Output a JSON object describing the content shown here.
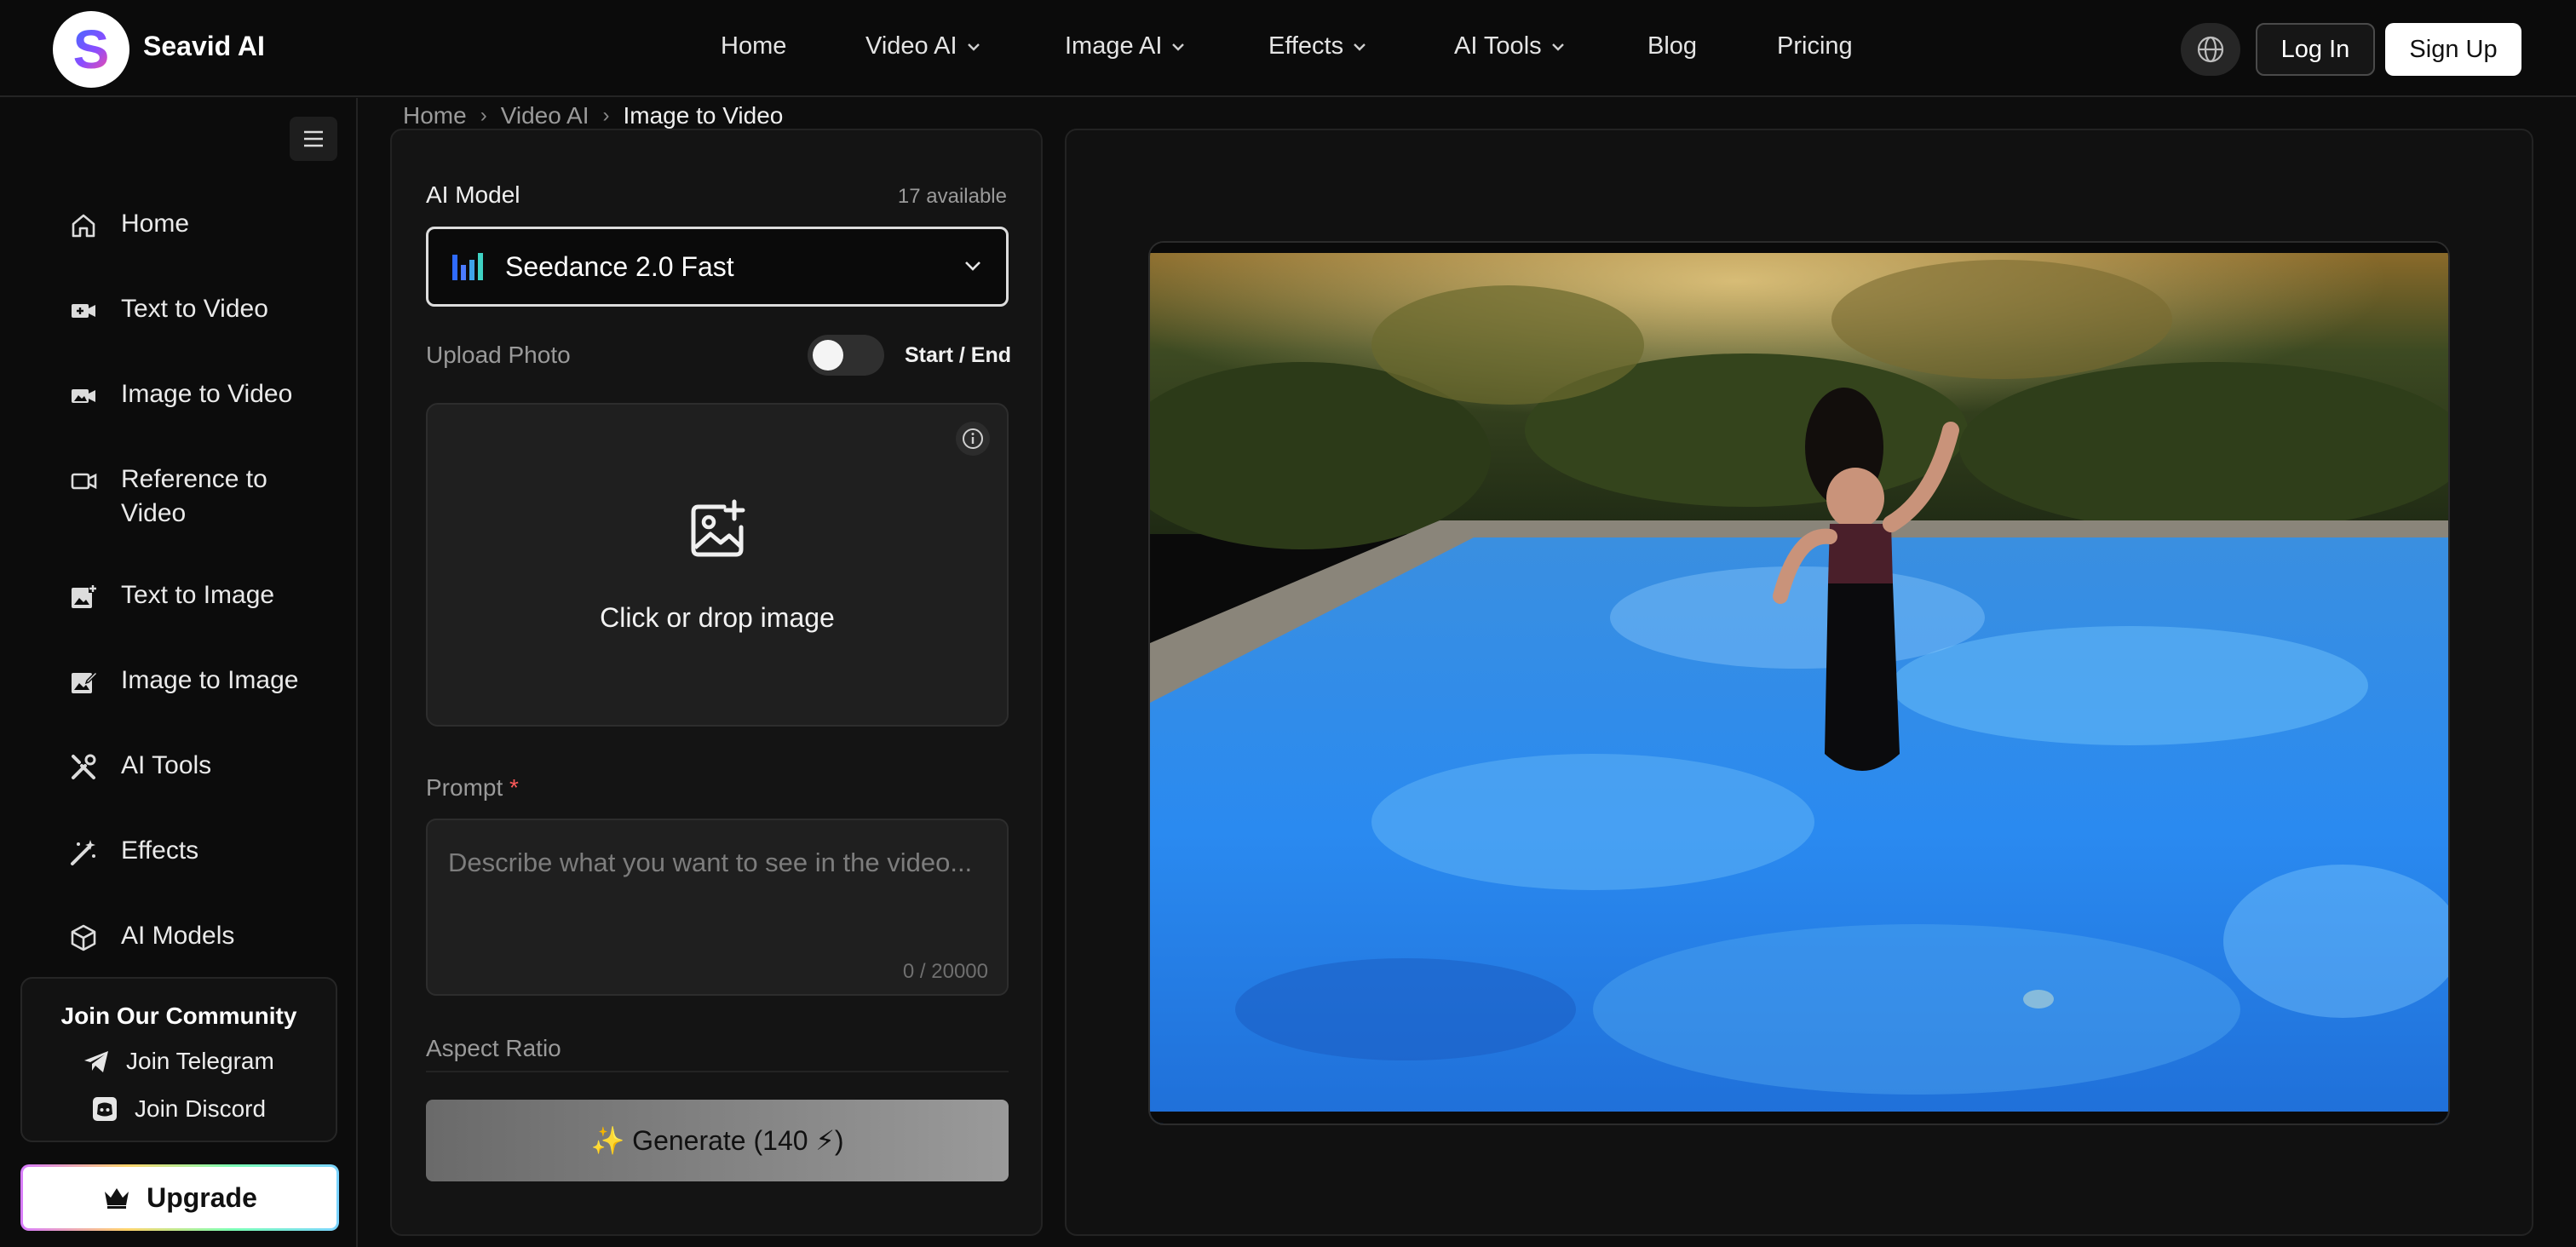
{
  "brand": {
    "logo_letter": "S",
    "name": "Seavid AI"
  },
  "nav": {
    "items": [
      {
        "label": "Home",
        "dropdown": false
      },
      {
        "label": "Video AI",
        "dropdown": true
      },
      {
        "label": "Image AI",
        "dropdown": true
      },
      {
        "label": "Effects",
        "dropdown": true
      },
      {
        "label": "AI Tools",
        "dropdown": true
      },
      {
        "label": "Blog",
        "dropdown": false
      },
      {
        "label": "Pricing",
        "dropdown": false
      }
    ],
    "language_icon": "globe-icon",
    "login_label": "Log In",
    "signup_label": "Sign Up"
  },
  "sidebar": {
    "items": [
      {
        "label": "Home",
        "icon": "home-icon"
      },
      {
        "label": "Text to Video",
        "icon": "video-plus-icon"
      },
      {
        "label": "Image to Video",
        "icon": "image-video-icon"
      },
      {
        "label": "Reference to Video",
        "icon": "video-camera-icon"
      },
      {
        "label": "Text to Image",
        "icon": "image-plus-icon"
      },
      {
        "label": "Image to Image",
        "icon": "image-edit-icon"
      },
      {
        "label": "AI Tools",
        "icon": "tools-icon"
      },
      {
        "label": "Effects",
        "icon": "magic-wand-icon"
      },
      {
        "label": "AI Models",
        "icon": "cube-icon"
      }
    ],
    "community": {
      "title": "Join Our Community",
      "telegram_label": "Join Telegram",
      "discord_label": "Join Discord"
    },
    "upgrade_label": "Upgrade"
  },
  "breadcrumb": [
    "Home",
    "Video AI",
    "Image to Video"
  ],
  "form": {
    "model_label": "AI Model",
    "model_count": "17 available",
    "model_selected": "Seedance 2.0 Fast",
    "upload_label": "Upload Photo",
    "start_end_label": "Start / End",
    "start_end_enabled": false,
    "upload_hint": "Click or drop image",
    "prompt_label": "Prompt",
    "prompt_required_mark": "*",
    "prompt_value": "",
    "prompt_placeholder": "Describe what you want to see in the video...",
    "prompt_counter": "0 / 20000",
    "aspect_ratio_label": "Aspect Ratio",
    "generate_label": "✨ Generate (140 ⚡)"
  },
  "colors": {
    "background": "#0d0d0d",
    "panel": "#141414",
    "accent_white": "#ffffff",
    "required": "#ff5a5a",
    "model_logo_blue": "#2f6bff",
    "model_logo_teal": "#3fd3c4"
  }
}
